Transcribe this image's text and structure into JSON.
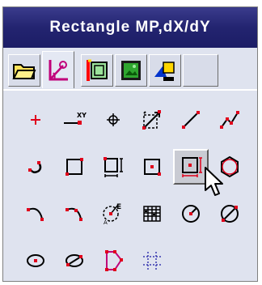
{
  "window": {
    "title": "Rectangle MP,dX/dY"
  },
  "tabs": [
    {
      "icon": "folder-icon"
    },
    {
      "icon": "ucs-axis-icon",
      "active": true
    },
    {
      "icon": "layer-box-icon"
    },
    {
      "icon": "image-icon"
    },
    {
      "icon": "shapes-icon"
    },
    {
      "icon": "empty-tab"
    }
  ],
  "tools": [
    {
      "icon": "point-plus-icon"
    },
    {
      "icon": "xy-coordinate-icon"
    },
    {
      "icon": "crosshair-circle-icon"
    },
    {
      "icon": "rotate-box-icon"
    },
    {
      "icon": "line-icon"
    },
    {
      "icon": "polyline-icon"
    },
    {
      "icon": "curve-hook-icon"
    },
    {
      "icon": "rectangle-icon"
    },
    {
      "icon": "rectangle-dimension-icon"
    },
    {
      "icon": "rectangle-center-icon"
    },
    {
      "icon": "rectangle-mp-dxdy-icon",
      "pressed": true
    },
    {
      "icon": "hexagon-icon"
    },
    {
      "icon": "arc-icon"
    },
    {
      "icon": "arc-point-icon"
    },
    {
      "icon": "circle-edit-icon"
    },
    {
      "icon": "grid-pattern-icon"
    },
    {
      "icon": "circle-radius-icon"
    },
    {
      "icon": "circle-slash-icon"
    },
    {
      "icon": "ellipse-icon"
    },
    {
      "icon": "ellipse-slash-icon"
    },
    {
      "icon": "polygon-shape-icon"
    },
    {
      "icon": "dashed-grid-icon"
    }
  ],
  "colors": {
    "titlebar": "#1f2070",
    "panel": "#dfe3ef",
    "accent": "#e0001b"
  }
}
